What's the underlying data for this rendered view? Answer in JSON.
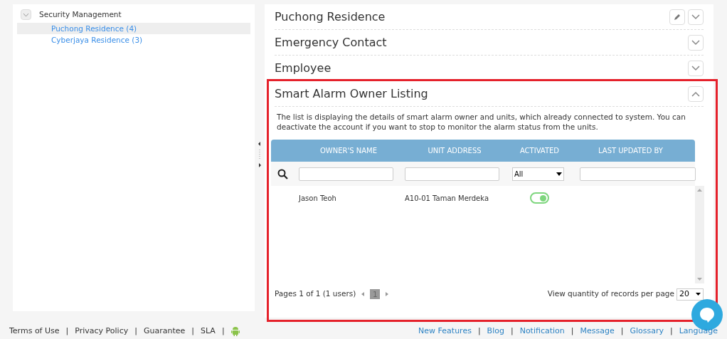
{
  "tree": {
    "label": "Security Management",
    "expanded": true,
    "children": [
      {
        "label": "Puchong Residence (4)",
        "selected": true
      },
      {
        "label": "Cyberjaya Residence (3)",
        "selected": false
      }
    ]
  },
  "sections": [
    {
      "title": "Puchong Residence",
      "expanded": false,
      "editable": true
    },
    {
      "title": "Emergency Contact",
      "expanded": false,
      "editable": false
    },
    {
      "title": "Employee",
      "expanded": false,
      "editable": false
    },
    {
      "title": "Smart Alarm Owner Listing",
      "expanded": true,
      "editable": false,
      "highlighted": true
    }
  ],
  "listing": {
    "description": "The list is displaying the details of smart alarm owner and units, which already connected to system. You can deactivate the account if you want to stop to monitor the alarm status from the units.",
    "columns": [
      "OWNER'S NAME",
      "UNIT ADDRESS",
      "ACTIVATED",
      "LAST UPDATED BY"
    ],
    "activated_filter": "All",
    "rows": [
      {
        "owner": "Jason Teoh",
        "address": "A10-01 Taman Merdeka",
        "activated": true
      }
    ],
    "pagination": {
      "summary": "Pages 1 of 1 (1 users)",
      "pages": [
        {
          "label": "1",
          "selected": true
        }
      ],
      "per_page_label": "View quantity of records per page",
      "per_page": "20"
    }
  },
  "footer_left": [
    {
      "label": "Terms of Use",
      "divider": "|"
    },
    {
      "label": "Privacy Policy",
      "divider": "|"
    },
    {
      "label": "Guarantee",
      "divider": "|"
    },
    {
      "label": "SLA",
      "divider": "|"
    }
  ],
  "footer_right": [
    {
      "label": "New Features",
      "divider": "|"
    },
    {
      "label": "Blog",
      "divider": "|"
    },
    {
      "label": "Notification",
      "divider": "|"
    },
    {
      "label": "Message",
      "divider": "|"
    },
    {
      "label": "Glossary",
      "divider": "|"
    },
    {
      "label": "Language"
    }
  ]
}
